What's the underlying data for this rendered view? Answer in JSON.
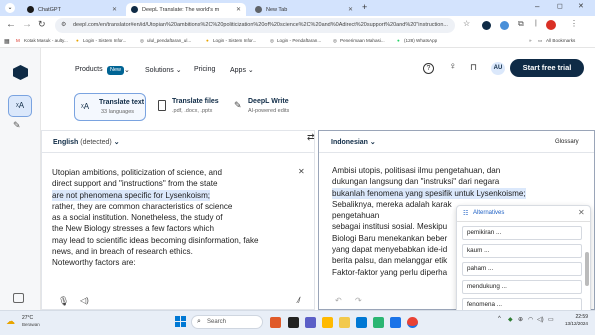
{
  "browser": {
    "tabs": [
      {
        "label": "ChatGPT",
        "color": "#1a1a1a"
      },
      {
        "label": "DeepL Translate: The world's m",
        "color": "#0f2b46"
      },
      {
        "label": "New Tab",
        "color": "#5f6368"
      }
    ],
    "url": "deepl.com/en/translator#en/id/Utopian%20ambitions%2C%20politicization%20of%20science%2C%20and%0Adirect%20support%20and%20\"instruction...",
    "bookmarks": [
      "Kotak Masuk - aulty...",
      "Login - Sistem Infor...",
      "ulul_pendaftaran_ul...",
      "Login - Sistem Infor...",
      "Login - Pendaftaran...",
      "Penerimaan Mahasi...",
      "(128) WhatsApp",
      "All Bookmarks"
    ]
  },
  "header": {
    "nav": [
      "Products",
      "Solutions",
      "Pricing",
      "Apps"
    ],
    "new_badge": "New",
    "avatar": "AU",
    "cta": "Start free trial"
  },
  "modes": [
    {
      "title": "Translate text",
      "sub": "33 languages"
    },
    {
      "title": "Translate files",
      "sub": ".pdf, .docx, .pptx"
    },
    {
      "title": "DeepL Write",
      "sub": "AI-powered edits"
    }
  ],
  "source": {
    "lang": "English",
    "detected": "(detected)",
    "lines": [
      "Utopian ambitions, politicization of science, and",
      "direct support and \"instructions\" from the state",
      "are not phenomena specific for Lysenkoism;",
      "rather, they are common characteristics of science",
      "as a social institution. Nonetheless, the study of",
      "the New Biology stresses a few factors which",
      "may lead to scientific ideas becoming disinformation, fake",
      "news, and in breach of research ethics.",
      "Noteworthy factors are:"
    ]
  },
  "target": {
    "lang": "Indonesian",
    "glossary": "Glossary",
    "lines": [
      "Ambisi utopis, politisasi ilmu pengetahuan, dan",
      "dukungan langsung dan \"instruksi\" dari negara",
      "bukanlah fenomena yang spesifik untuk Lysenkoisme;",
      "Sebaliknya, mereka adalah karak",
      "pengetahuan",
      "sebagai institusi sosial. Meskipu",
      "Biologi Baru menekankan beber",
      "yang dapat menyebabkan ide-id",
      "berita palsu, dan melanggar etik",
      "Faktor-faktor yang perlu diperha"
    ]
  },
  "alternatives": {
    "title": "Alternatives",
    "items": [
      "pemikiran ...",
      "kaum ...",
      "paham ...",
      "mendukung ...",
      "fenomena ..."
    ]
  },
  "taskbar": {
    "weather_temp": "27°C",
    "weather_desc": "Berawan",
    "search": "Search",
    "time": "22:59",
    "date": "13/12/2024"
  }
}
